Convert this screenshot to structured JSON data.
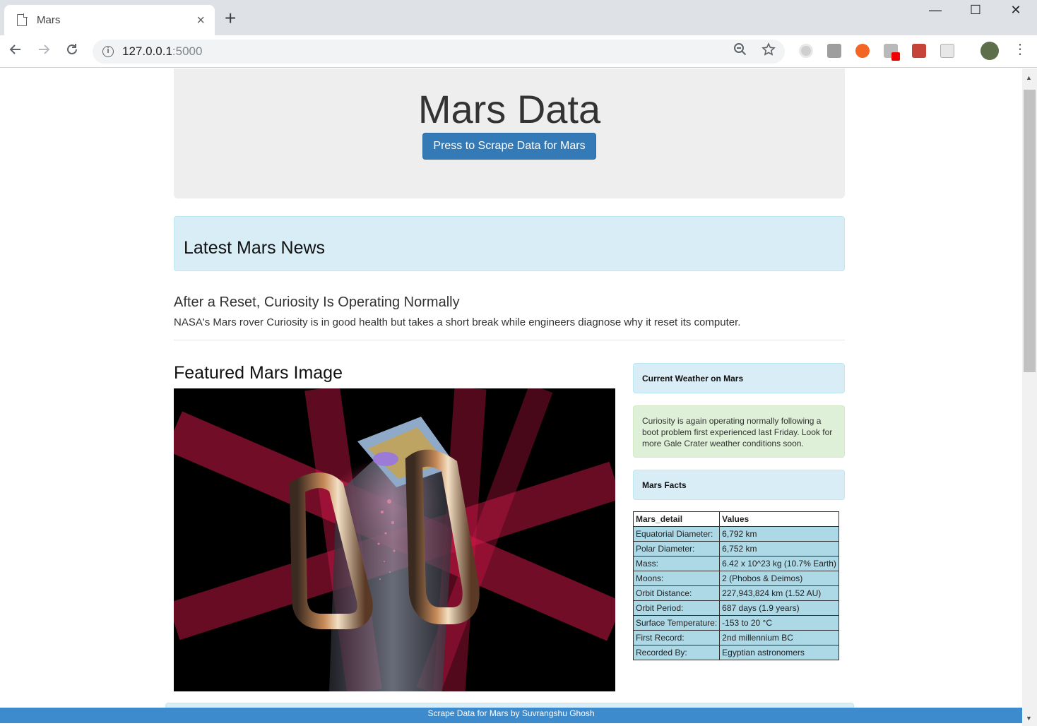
{
  "browser": {
    "tab_title": "Mars",
    "tab_close": "×",
    "new_tab": "+",
    "url_host": "127.0.0.1",
    "url_port": ":5000",
    "window_controls": {
      "minimize": "—",
      "maximize": "☐",
      "close": "✕"
    }
  },
  "header": {
    "title": "Mars Data",
    "scrape_button": "Press to Scrape Data for Mars"
  },
  "news": {
    "section_title": "Latest Mars News",
    "headline": "After a Reset, Curiosity Is Operating Normally",
    "paragraph": "NASA's Mars rover Curiosity is in good health but takes a short break while engineers diagnose why it reset its computer."
  },
  "featured": {
    "title": "Featured Mars Image"
  },
  "weather": {
    "title": "Current Weather on Mars",
    "text": "Curiosity is again operating normally following a boot problem first experienced last Friday. Look for more Gale Crater weather conditions soon."
  },
  "facts": {
    "title": "Mars Facts",
    "headers": [
      "Mars_detail",
      "Values"
    ],
    "rows": [
      [
        "Equatorial Diameter:",
        "6,792 km"
      ],
      [
        "Polar Diameter:",
        "6,752 km"
      ],
      [
        "Mass:",
        "6.42 x 10^23 kg (10.7% Earth)"
      ],
      [
        "Moons:",
        "2 (Phobos & Deimos)"
      ],
      [
        "Orbit Distance:",
        "227,943,824 km (1.52 AU)"
      ],
      [
        "Orbit Period:",
        "687 days (1.9 years)"
      ],
      [
        "Surface Temperature:",
        "-153 to 20 °C"
      ],
      [
        "First Record:",
        "2nd millennium BC"
      ],
      [
        "Recorded By:",
        "Egyptian astronomers"
      ]
    ]
  },
  "footer": {
    "text": "Scrape Data for Mars by Suvrangshu Ghosh"
  },
  "colors": {
    "primary_button": "#337ab7",
    "info_panel": "#d9edf7",
    "success_panel": "#dff0d8",
    "table_cell": "#add8e6",
    "footer": "#3d8bcd"
  }
}
